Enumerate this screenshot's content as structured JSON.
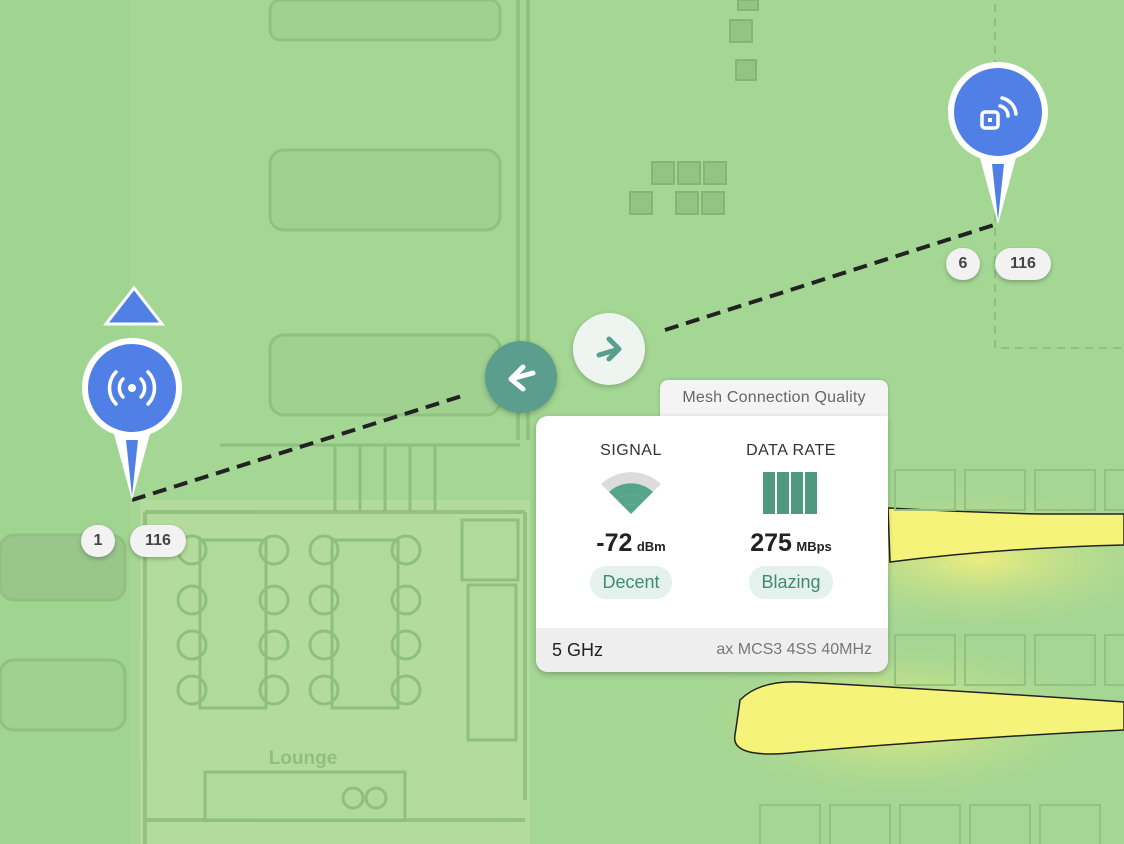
{
  "map": {
    "room_label": "Lounge"
  },
  "nodes": [
    {
      "id_badge": "1",
      "channel_badge": "116",
      "icon": "broadcast-icon"
    },
    {
      "id_badge": "6",
      "channel_badge": "116",
      "icon": "nfc-device-icon"
    }
  ],
  "direction_buttons": {
    "left": "arrow-left-icon",
    "right": "arrow-right-icon"
  },
  "connection_card": {
    "tab_title": "Mesh Connection Quality",
    "signal": {
      "title": "SIGNAL",
      "value": "-72",
      "unit": "dBm",
      "rating": "Decent"
    },
    "data_rate": {
      "title": "DATA RATE",
      "value": "275",
      "unit": "MBps",
      "rating": "Blazing"
    },
    "band": "5 GHz",
    "mcs": "ax MCS3 4SS 40MHz"
  },
  "colors": {
    "pin_blue": "#5080e6",
    "accent_green": "#3d8c73",
    "heatmap_green": "#a3d593",
    "heatmap_yellow": "#f6f37a"
  }
}
